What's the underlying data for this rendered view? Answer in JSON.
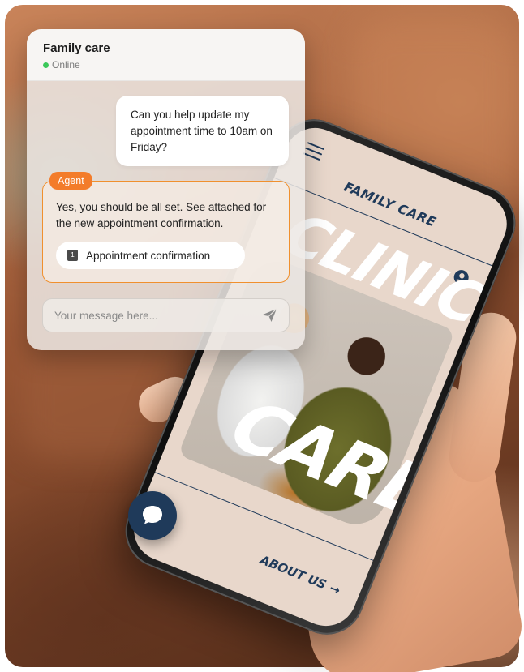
{
  "chat": {
    "title": "Family care",
    "status": "Online",
    "user_message": "Can you help update my appointment time to 10am on Friday?",
    "agent_badge": "Agent",
    "agent_message": "Yes, you should be all set. See attached for the new appointment confirmation.",
    "attachment_label": "Appointment confirmation",
    "attachment_icon": "calendar-icon",
    "attachment_icon_text": "1",
    "input_placeholder": "Your message here...",
    "send_icon": "send-icon"
  },
  "phone_site": {
    "brand": "FAMILY CARE",
    "hero_word_1": "CLINIC",
    "hero_word_2": "CARE",
    "about_link": "ABOUT US",
    "about_arrow": "→",
    "menu_icon": "hamburger-icon",
    "profile_icon": "profile-icon",
    "launcher_icon": "chat-bubble-icon"
  },
  "colors": {
    "navy": "#1f3a5a",
    "agent_orange": "#f37c2a",
    "online_green": "#3cc85a",
    "screen_beige": "#e8d7cb"
  }
}
